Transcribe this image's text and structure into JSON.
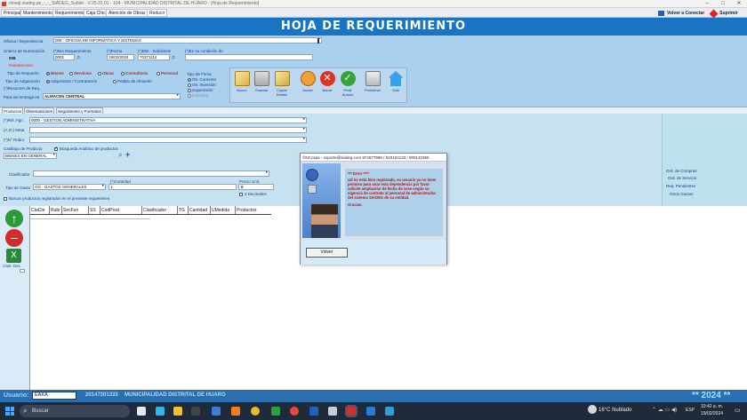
{
  "window": {
    "title": "mosql.siadeg.pe_-_-_SIADEG_Sublet - V-25.01.01 - 104 - MUNICIPALIDAD DISTRITAL DE HUARO - [Hoja de Requerimiento]"
  },
  "menu_tabs": [
    "Principal",
    "Mantenimiento",
    "Requerimiento",
    "Caja Chica",
    "Atención de Obras",
    "Reducir"
  ],
  "top_right": {
    "volver": "Volver a Conectar",
    "salir": "Suprimir"
  },
  "header": {
    "title": "HOJA DE REQUERIMIENTO"
  },
  "form": {
    "oficina_label": "Oficina / Dependencia",
    "oficina_value": "008 - OFICINA DE INFORMATICA Y SISTEMAS",
    "criterio_label": "Criterio de Numeración",
    "nro_req_label": "(*)Nro Requerimiento",
    "fecha_label": "(*)Fecha",
    "dni_label": "(*)DNI - Solicitante",
    "condicion_label": "(*)En su condición de",
    "criterio_value": "008",
    "nro_req_value": "0001",
    "fecha_value": "19/02/2024",
    "dni_value": "70371114",
    "code_value": "R20082024001",
    "tipo_req_label": "Tipo de Requerim.",
    "tipo_req_options": [
      "Bienes",
      "Servicios",
      "Obras",
      "Consultoría",
      "Personal"
    ],
    "tipo_adq_label": "Tipo de Adquisición",
    "tipo_adq_options": [
      "Adquisición / Contratación",
      "Pedido de Almacén"
    ],
    "resumen_label": "(*)Resumen de Req.",
    "entrega_label": "Para ser Entrega en",
    "entrega_value": "ALMACEN CENTRAL",
    "tipo_firma_label": "Tipo de Firma",
    "tipo_firma_options": [
      "Otr. Corriente",
      "Otr. Inversión",
      "Supervisión",
      "Inversión"
    ]
  },
  "toolbar": {
    "nuevo": "Nuevo",
    "guardar": "Guardar",
    "copiar": "Copiar Detalle",
    "anular": "Anular",
    "borrar": "Borrar",
    "pedir_autoriz": "Pedir Autoriz",
    "preliminar": "Preliminar",
    "salir": "Salir"
  },
  "section_tabs": [
    "Productos",
    "Observaciones",
    "Seguimiento y Formatos"
  ],
  "products": {
    "rel_fgn_label": "(*)Rel. Fgn",
    "rel_fgn_value": "0000 - GESTION ADMINISTRATIVA",
    "meta_label": "(A.O.) Meta",
    "rubro_label": "(*)N° Rubro",
    "catalogo_label": "Catálogo de Producto",
    "busqueda_label": "Búsqueda Analítico de productos",
    "catalogo_value": "BIENES EN GENERAL",
    "clasificador_label": "Clasificador",
    "cantidad_label": "(*)Cantidad",
    "cantidad_value": "1",
    "precio_label": "Precio Unit.",
    "precio_value": "0",
    "decimales_label": "4 Decimales",
    "tipo_gasto_label": "Tipo de Gasto",
    "tipo_gasto_value": "GG - GASTOS GENERALES",
    "buscar_label": "Buscar productos registrados en el presente requerimien"
  },
  "right_links": [
    "Ord. de Compras",
    "Ord. de Servicio",
    "Req. Pendientes",
    "Otros Gastos"
  ],
  "grid_columns": [
    "CtaCte",
    "Rubr",
    "SecFun",
    "SS",
    "CodProd",
    "Clasificador",
    "TG",
    "Cantidad",
    "UMedida",
    "Productos"
  ],
  "left_tools": {
    "cant_det": "Cant. Det."
  },
  "dialog": {
    "title": "©NCcapa - soporte@siadeg.com 974677988 / 910104133 / 900132366",
    "error_title": "*** Error ****",
    "message": "Ud no esta bien registrado, su usuario ya no tiene permiso para usar esta dependencia por favor solicite ampliación de fecha de cese según su vigencia de contrato al personal de administrador del sistema SIADEG de su entidad.",
    "gracias": "Gracias.",
    "volver": "Volver"
  },
  "status": {
    "usuario_label": "Usuario:",
    "usuario_value": "EAKA",
    "ruc": "20147301333",
    "entidad": "MUNICIPALIDAD DISTRITAL DE HUARO",
    "year": "** 2024 **"
  },
  "taskbar": {
    "search": "Buscar",
    "weather": "16°C  Nublado",
    "lang": "ESP",
    "time": "10:42 a. m.",
    "date": "19/02/2024"
  }
}
